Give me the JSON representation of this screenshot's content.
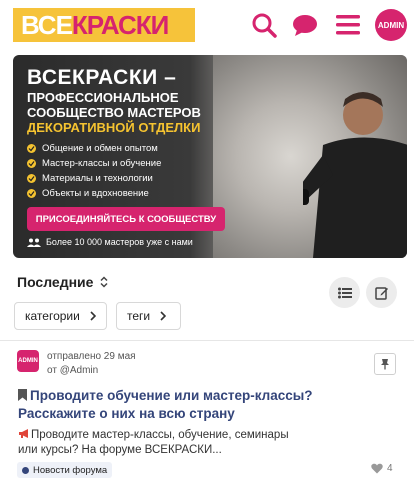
{
  "header": {
    "logo_white": "ВСЕ",
    "logo_pink": "КРАСКИ",
    "avatar_label": "ADMIN"
  },
  "banner": {
    "title": "ВСЕКРАСКИ –",
    "subtitle_line1": "ПРОФЕССИОНАЛЬНОЕ",
    "subtitle_line2": "СООБЩЕСТВО МАСТЕРОВ",
    "subtitle_line3": "ДЕКОРАТИВНОЙ ОТДЕЛКИ",
    "features": [
      "Общение и обмен опытом",
      "Мастер-классы и обучение",
      "Материалы и технологии",
      "Объекты и вдохновение"
    ],
    "cta_label": "ПРИСОЕДИНЯЙТЕСЬ К СООБЩЕСТВУ",
    "members_text": "Более 10 000 мастеров уже с нами"
  },
  "filters": {
    "sort_label": "Последние",
    "categories_label": "категории",
    "tags_label": "теги"
  },
  "topic": {
    "avatar_label": "ADMIN",
    "posted_line": "отправлено 29 мая",
    "author_line": "от @Admin",
    "title": "Проводите обучение или мастер-классы? Расскажите о них на всю страну",
    "excerpt": "Проводите мастер-классы, обучение, семинары или курсы? На форуме ВСЕКРАСКИ...",
    "category": "Новости форума",
    "likes": "4"
  },
  "colors": {
    "brand_pink": "#d6246e",
    "brand_yellow": "#f6c33a",
    "link_blue": "#34457a"
  },
  "icons": [
    "search-icon",
    "chat-icon",
    "menu-icon",
    "sort-toggle-icon",
    "list-view-icon",
    "new-topic-icon",
    "chevron-right-icon",
    "pin-icon",
    "bookmark-icon",
    "megaphone-icon",
    "heart-icon",
    "members-icon",
    "check-icon"
  ]
}
